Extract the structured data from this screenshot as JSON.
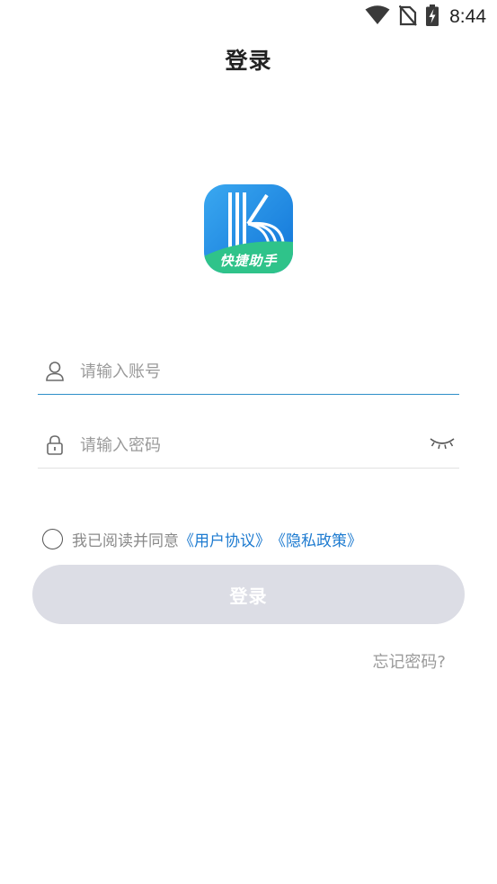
{
  "status_bar": {
    "time": "8:44",
    "icons": [
      "wifi-icon",
      "no-sim-icon",
      "battery-charging-icon"
    ]
  },
  "header": {
    "title": "登录"
  },
  "logo": {
    "caption": "快捷助手",
    "colors": {
      "gradient_start": "#3aa8f0",
      "gradient_end": "#1174d8",
      "wave": "#2fc38a"
    }
  },
  "form": {
    "account": {
      "placeholder": "请输入账号",
      "value": "",
      "icon": "user-icon"
    },
    "password": {
      "placeholder": "请输入密码",
      "value": "",
      "icon": "lock-icon",
      "toggle_icon": "eye-closed-icon"
    }
  },
  "agreement": {
    "checked": false,
    "text": "我已阅读并同意",
    "user_agreement": "《用户协议》",
    "privacy_policy": "《隐私政策》"
  },
  "actions": {
    "login_label": "登录",
    "forgot_password": "忘记密码?"
  },
  "colors": {
    "accent_link": "#1e7bd0",
    "active_underline": "#2e8fc8",
    "button_disabled": "#dcdde5"
  }
}
